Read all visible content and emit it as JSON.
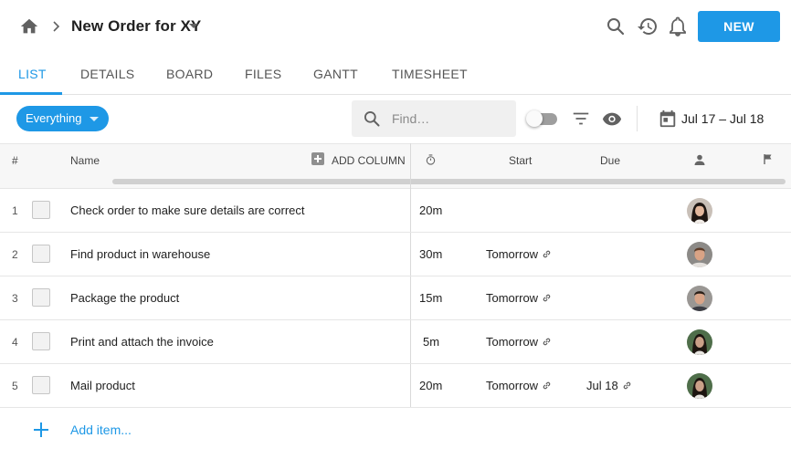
{
  "header": {
    "title": "New Order for XY",
    "new_button": "NEW"
  },
  "tabs": [
    {
      "label": "LIST",
      "active": true
    },
    {
      "label": "DETAILS"
    },
    {
      "label": "BOARD"
    },
    {
      "label": "FILES"
    },
    {
      "label": "GANTT"
    },
    {
      "label": "TIMESHEET"
    }
  ],
  "toolbar": {
    "filter_chip": "Everything",
    "search_placeholder": "Find…",
    "date_range": "Jul 17 – Jul 18"
  },
  "table": {
    "columns": {
      "index": "#",
      "name": "Name",
      "add_column": "ADD COLUMN",
      "start": "Start",
      "due": "Due"
    },
    "rows": [
      {
        "index": "1",
        "name": "Check order to make sure details are correct",
        "duration": "20m",
        "start": "",
        "due": "",
        "assignee": "woman-dark-hair"
      },
      {
        "index": "2",
        "name": "Find product in warehouse",
        "duration": "30m",
        "start": "Tomorrow",
        "due": "",
        "assignee": "man-brown-hair"
      },
      {
        "index": "3",
        "name": "Package the product",
        "duration": "15m",
        "start": "Tomorrow",
        "due": "",
        "assignee": "man-dark-hair"
      },
      {
        "index": "4",
        "name": "Print and attach the invoice",
        "duration": "5m",
        "start": "Tomorrow",
        "due": "",
        "assignee": "woman-outdoor"
      },
      {
        "index": "5",
        "name": "Mail product",
        "duration": "20m",
        "start": "Tomorrow",
        "due": "Jul 18",
        "assignee": "woman-outdoor"
      }
    ],
    "add_item": "Add item..."
  },
  "colors": {
    "accent": "#1e98e6",
    "header_bg": "#f7f7f7",
    "border": "#e6e6e6"
  }
}
